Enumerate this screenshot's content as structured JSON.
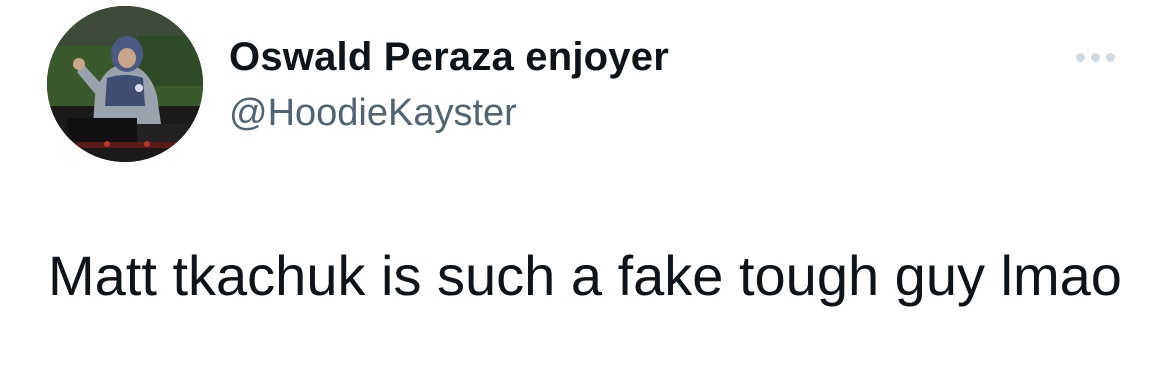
{
  "author": {
    "display_name": "Oswald Peraza enjoyer",
    "handle": "@HoodieKayster",
    "avatar_icon": "user-avatar-photo"
  },
  "tweet": {
    "text": "Matt tkachuk is such a fake tough guy lmao"
  },
  "actions": {
    "more_icon": "more-horizontal-icon"
  },
  "colors": {
    "text_primary": "#0f1419",
    "text_secondary": "#536471",
    "more_dots": "#cfd9de"
  }
}
